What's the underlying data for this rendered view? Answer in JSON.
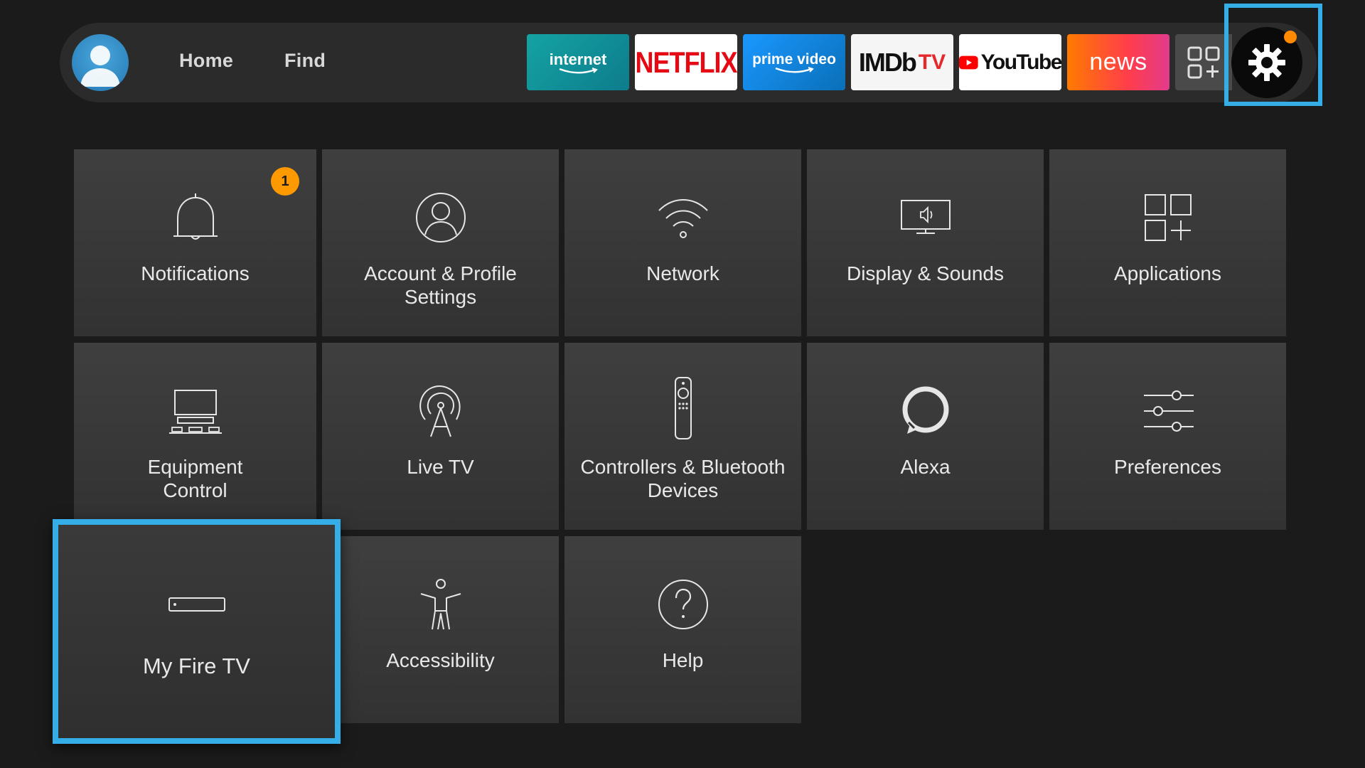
{
  "header": {
    "nav": [
      {
        "label": "Home"
      },
      {
        "label": "Find"
      }
    ],
    "apps": [
      {
        "name": "internet",
        "label": "internet"
      },
      {
        "name": "netflix",
        "label": "NETFLIX"
      },
      {
        "name": "prime-video",
        "label": "prime video"
      },
      {
        "name": "imdb-tv",
        "label": "IMDb",
        "label_suffix": "TV"
      },
      {
        "name": "youtube",
        "label": "YouTube"
      },
      {
        "name": "news",
        "label": "news"
      },
      {
        "name": "all-apps",
        "icon": "apps-grid-icon"
      }
    ],
    "settings": {
      "icon": "gear-icon",
      "notification_dot_color": "#ff8a00",
      "focus_color": "#35aee8"
    }
  },
  "settings_grid": {
    "tiles": [
      {
        "id": "notifications",
        "label": "Notifications",
        "icon": "bell-icon",
        "badge": "1"
      },
      {
        "id": "account",
        "label": "Account & Profile Settings",
        "icon": "user-icon"
      },
      {
        "id": "network",
        "label": "Network",
        "icon": "wifi-icon"
      },
      {
        "id": "display",
        "label": "Display & Sounds",
        "icon": "monitor-speaker-icon"
      },
      {
        "id": "applications",
        "label": "Applications",
        "icon": "apps-grid-icon"
      },
      {
        "id": "equipment",
        "label": "Equipment Control",
        "icon": "tv-equipment-icon"
      },
      {
        "id": "live-tv",
        "label": "Live TV",
        "icon": "antenna-icon"
      },
      {
        "id": "controllers",
        "label": "Controllers & Bluetooth Devices",
        "icon": "remote-icon"
      },
      {
        "id": "alexa",
        "label": "Alexa",
        "icon": "alexa-icon"
      },
      {
        "id": "preferences",
        "label": "Preferences",
        "icon": "sliders-icon"
      },
      {
        "id": "my-fire-tv",
        "label": "My Fire TV",
        "icon": "fire-tv-device-icon",
        "focused": true
      },
      {
        "id": "accessibility",
        "label": "Accessibility",
        "icon": "accessibility-icon"
      },
      {
        "id": "help",
        "label": "Help",
        "icon": "help-icon"
      }
    ]
  },
  "colors": {
    "background": "#1b1b1b",
    "tile": "#3a3a3a",
    "focus_outline": "#35aee8",
    "badge": "#ff9900"
  }
}
